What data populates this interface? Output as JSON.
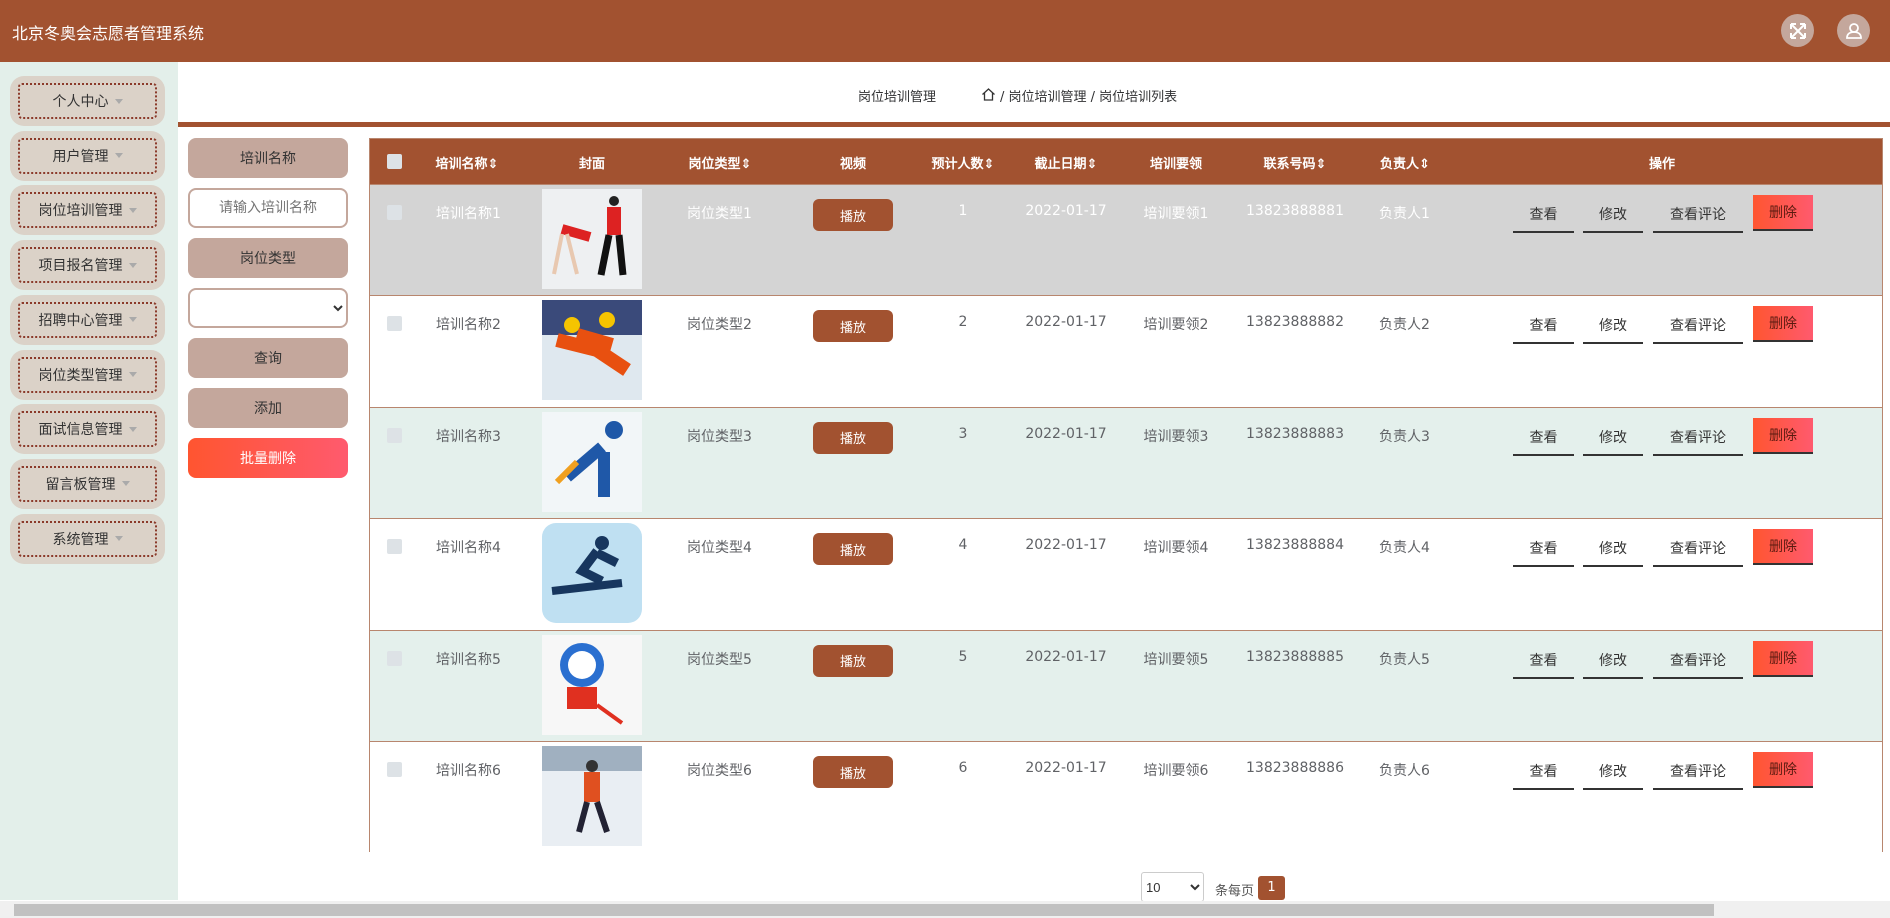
{
  "app": {
    "title": "北京冬奥会志愿者管理系统"
  },
  "sidebar": {
    "items": [
      {
        "label": "个人中心"
      },
      {
        "label": "用户管理"
      },
      {
        "label": "岗位培训管理"
      },
      {
        "label": "项目报名管理"
      },
      {
        "label": "招聘中心管理"
      },
      {
        "label": "岗位类型管理"
      },
      {
        "label": "面试信息管理"
      },
      {
        "label": "留言板管理"
      },
      {
        "label": "系统管理"
      }
    ]
  },
  "breadcrumb": {
    "title": "岗位培训管理",
    "path": "/ 岗位培训管理 / 岗位培训列表"
  },
  "search": {
    "name_label": "培训名称",
    "name_placeholder": "请输入培训名称",
    "type_label": "岗位类型",
    "query": "查询",
    "add": "添加",
    "batch_delete": "批量删除"
  },
  "table": {
    "headers": {
      "name": "培训名称⇕",
      "cover": "封面",
      "type": "岗位类型⇕",
      "video": "视频",
      "count": "预计人数⇕",
      "date": "截止日期⇕",
      "points": "培训要领",
      "phone": "联系号码⇕",
      "owner": "负责人⇕",
      "ops": "操作"
    },
    "play_label": "播放",
    "actions": {
      "view": "查看",
      "edit": "修改",
      "comments": "查看评论",
      "delete": "删除"
    },
    "rows": [
      {
        "name": "培训名称1",
        "type": "岗位类型1",
        "count": "1",
        "date": "2022-01-17",
        "points": "培训要领1",
        "phone": "13823888881",
        "owner": "负责人1",
        "cover": "figure-skating"
      },
      {
        "name": "培训名称2",
        "type": "岗位类型2",
        "count": "2",
        "date": "2022-01-17",
        "points": "培训要领2",
        "phone": "13823888882",
        "owner": "负责人2",
        "cover": "speed-skating"
      },
      {
        "name": "培训名称3",
        "type": "岗位类型3",
        "count": "3",
        "date": "2022-01-17",
        "points": "培训要领3",
        "phone": "13823888883",
        "owner": "负责人3",
        "cover": "ice-hockey-pictogram"
      },
      {
        "name": "培训名称4",
        "type": "岗位类型4",
        "count": "4",
        "date": "2022-01-17",
        "points": "培训要领4",
        "phone": "13823888884",
        "owner": "负责人4",
        "cover": "snowboard-pictogram"
      },
      {
        "name": "培训名称5",
        "type": "岗位类型5",
        "count": "5",
        "date": "2022-01-17",
        "points": "培训要领5",
        "phone": "13823888885",
        "owner": "负责人5",
        "cover": "mascot-hockey"
      },
      {
        "name": "培训名称6",
        "type": "岗位类型6",
        "count": "6",
        "date": "2022-01-17",
        "points": "培训要领6",
        "phone": "13823888886",
        "owner": "负责人6",
        "cover": "biathlon"
      }
    ]
  },
  "pagination": {
    "page_size": "10",
    "per_page_label": "条每页",
    "current_page": "1"
  },
  "colors": {
    "brand": "#a25230",
    "hover_row": "#d4d4d4",
    "alt_row": "#e4f0ec"
  }
}
